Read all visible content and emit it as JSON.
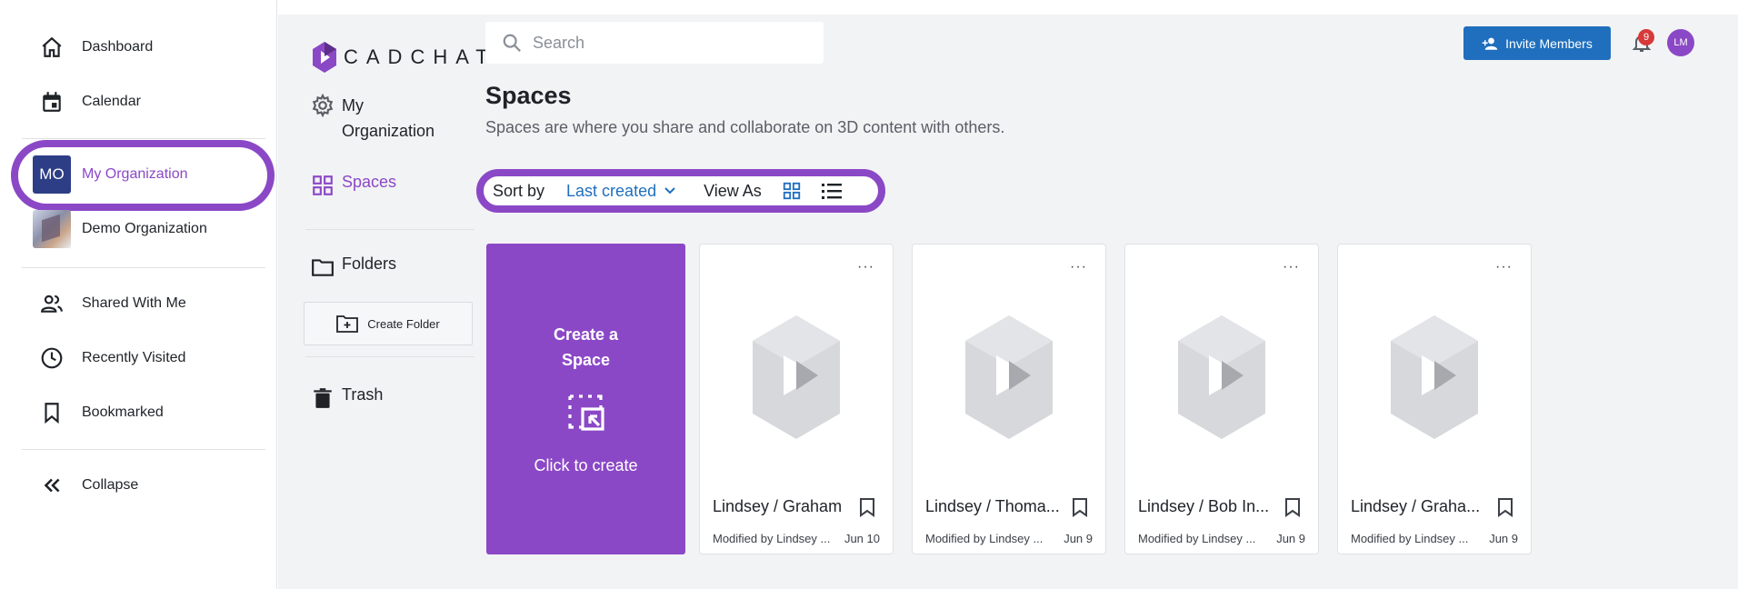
{
  "sidebar": {
    "nav_top": [
      {
        "label": "Dashboard",
        "icon": "home-icon"
      },
      {
        "label": "Calendar",
        "icon": "calendar-icon"
      }
    ],
    "orgs": [
      {
        "label": "My Organization",
        "badge": "MO",
        "badge_color": "#2d3e86",
        "active": true
      },
      {
        "label": "Demo Organization",
        "thumb": "organization-thumbnail"
      }
    ],
    "nav_bottom": [
      {
        "label": "Shared With Me",
        "icon": "people-icon"
      },
      {
        "label": "Recently Visited",
        "icon": "clock-icon"
      },
      {
        "label": "Bookmarked",
        "icon": "bookmark-icon"
      }
    ],
    "collapse_label": "Collapse"
  },
  "header": {
    "logo_text": "CADCHAT",
    "search_placeholder": "Search",
    "invite_label": "Invite Members",
    "notification_count": "9",
    "avatar_initials": "LM"
  },
  "subnav": {
    "org_label_line1": "My",
    "org_label_line2": "Organization",
    "spaces_label": "Spaces",
    "folders_label": "Folders",
    "create_folder_label": "Create Folder",
    "trash_label": "Trash"
  },
  "page": {
    "title": "Spaces",
    "subtitle": "Spaces are where you share and collaborate on 3D content with others."
  },
  "toolbar": {
    "sort_by_label": "Sort by",
    "sort_value": "Last created",
    "view_as_label": "View As"
  },
  "create_card": {
    "title_line1": "Create a",
    "title_line2": "Space",
    "action_label": "Click to create"
  },
  "spaces": [
    {
      "name": "Lindsey / Graham",
      "modified": "Modified by Lindsey ...",
      "date": "Jun 10"
    },
    {
      "name": "Lindsey / Thoma...",
      "modified": "Modified by Lindsey ...",
      "date": "Jun 9"
    },
    {
      "name": "Lindsey / Bob In...",
      "modified": "Modified by Lindsey ...",
      "date": "Jun 9"
    },
    {
      "name": "Lindsey / Graha...",
      "modified": "Modified by Lindsey ...",
      "date": "Jun 9"
    }
  ],
  "colors": {
    "accent_purple": "#8b48c6",
    "primary_blue": "#1f6fbe",
    "badge_navy": "#2d3e86",
    "notification_red": "#d63a3a"
  }
}
